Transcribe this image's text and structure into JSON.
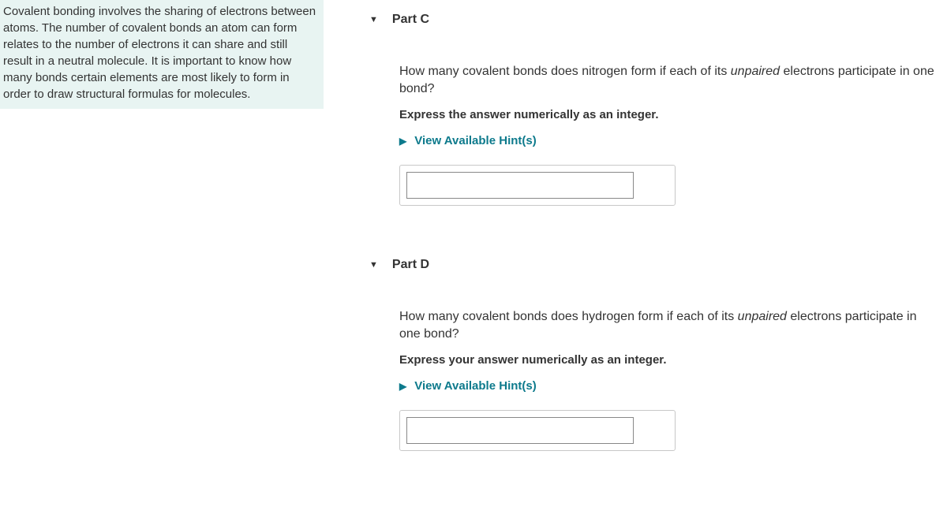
{
  "sidebar": {
    "intro_text": "Covalent bonding involves the sharing of electrons between atoms. The number of covalent bonds an atom can form relates to the number of electrons it can share and still result in a neutral molecule. It is important to know how many bonds certain elements are most likely to form in order to draw structural formulas for molecules."
  },
  "parts": {
    "c": {
      "title": "Part C",
      "question_prefix": "How many covalent bonds does nitrogen form if each of its ",
      "question_italic": "unpaired",
      "question_suffix": " electrons participate in one bond?",
      "instruction": "Express the answer numerically as an integer.",
      "hints_label": "View Available Hint(s)",
      "answer_value": ""
    },
    "d": {
      "title": "Part D",
      "question_prefix": "How many covalent bonds does hydrogen form if each of its ",
      "question_italic": "unpaired",
      "question_suffix": " electrons participate in one bond?",
      "instruction": "Express your answer numerically as an integer.",
      "hints_label": "View Available Hint(s)",
      "answer_value": ""
    }
  }
}
